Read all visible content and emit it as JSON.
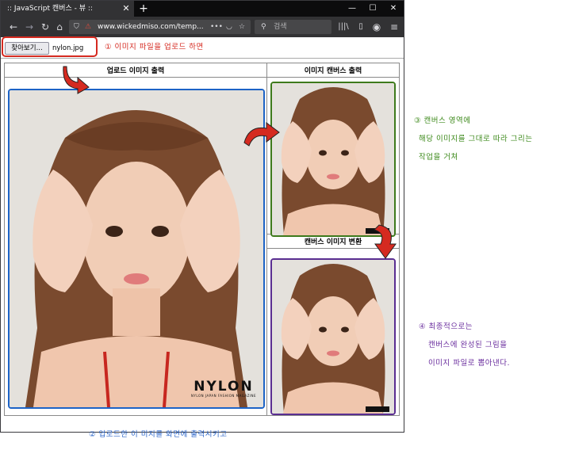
{
  "browser": {
    "tab_title": ":: JavaScript 캔버스 - 뷰 ::",
    "tab_close": "✕",
    "new_tab": "+",
    "url": "www.wickedmiso.com/temp...",
    "search_placeholder": "검색",
    "window_controls": [
      "minimize-icon",
      "maximize-icon",
      "close-icon"
    ]
  },
  "page": {
    "file_button_label": "찾아보기...",
    "file_name": "nylon.jpg",
    "table": {
      "upload_header": "업로드 이미지 출력",
      "canvas_header": "이미지 캔버스 출력",
      "convert_header": "캔버스 이미지 변환"
    },
    "magazine": {
      "brand": "NYLON",
      "tagline": "NYLON JAPAN FASHION MAGAZINE"
    }
  },
  "annotations": {
    "step1": "① 이미지 파일을 업로드 하면",
    "step2": "② 업로드한 이 미지를 화면에 출력시키고",
    "step3": [
      "③ 캔버스 영역에",
      "해당 이미지를 그대로 따라 그리는",
      "작업을 거쳐"
    ],
    "step4": [
      "④ 최종적으로는",
      "캔버스에 완성된 그림을",
      "이미지 파일로 뽑아낸다."
    ]
  },
  "colors": {
    "annot_red": "#d52a20",
    "annot_green": "#3e8a1c",
    "annot_purple": "#6a2e9e",
    "annot_blue": "#2d67c9",
    "frame_blue": "#1d63c6",
    "frame_green": "#3e7a1c",
    "frame_purple": "#5a2e91"
  }
}
